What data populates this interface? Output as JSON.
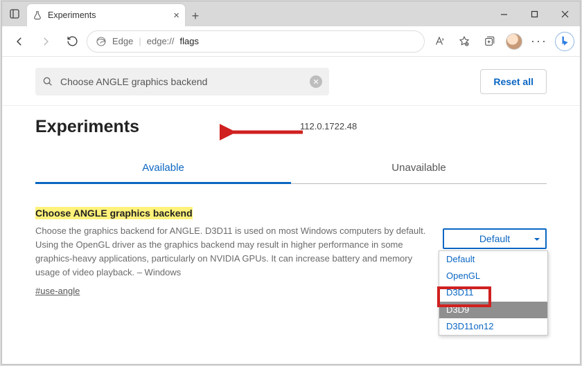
{
  "window": {
    "tab_title": "Experiments",
    "minimize": "–",
    "maximize": "☐",
    "close": "✕"
  },
  "toolbar": {
    "url_brand": "Edge",
    "url_prefix": "edge://",
    "url_bold": "flags"
  },
  "search": {
    "value": "Choose ANGLE graphics backend",
    "reset_label": "Reset all"
  },
  "page": {
    "title": "Experiments",
    "version": "112.0.1722.48"
  },
  "tabs": [
    {
      "label": "Available",
      "active": true
    },
    {
      "label": "Unavailable",
      "active": false
    }
  ],
  "flag": {
    "title": "Choose ANGLE graphics backend",
    "description": "Choose the graphics backend for ANGLE. D3D11 is used on most Windows computers by default. Using the OpenGL driver as the graphics backend may result in higher performance in some graphics-heavy applications, particularly on NVIDIA GPUs. It can increase battery and memory usage of video playback. – Windows",
    "id_text": "#use-angle",
    "selected": "Default",
    "options": [
      "Default",
      "OpenGL",
      "D3D11",
      "D3D9",
      "D3D11on12"
    ],
    "hovered_index": 3
  }
}
